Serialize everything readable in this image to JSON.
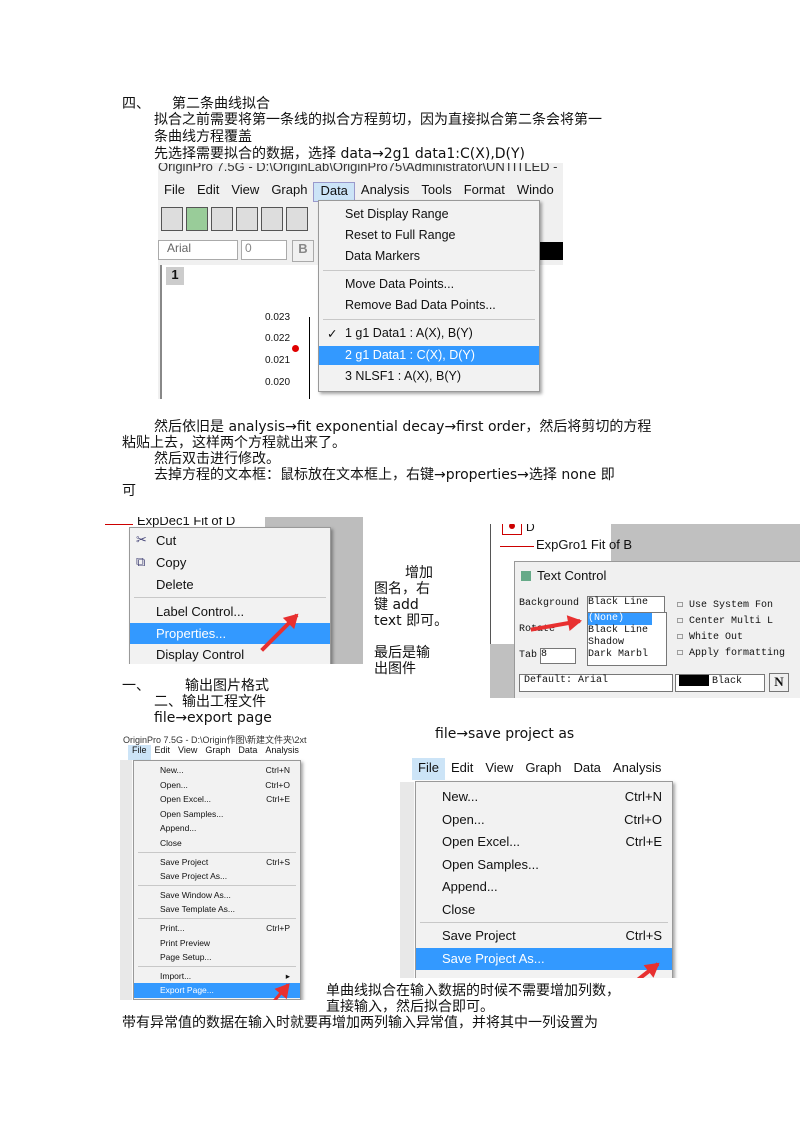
{
  "section4": {
    "num": "四、",
    "title": "第二条曲线拟合",
    "p1a": "拟合之前需要将第一条线的拟合方程剪切，因为直接拟合第二条会将第一",
    "p1b": "条曲线方程覆盖",
    "p2": "先选择需要拟合的数据，选择 data→2g1 data1:C(X),D(Y)"
  },
  "shot1": {
    "title": "OriginPro 7.5G - D:\\OriginLab\\OriginPro75\\Administrator\\UNTITLED -",
    "menus": [
      "File",
      "Edit",
      "View",
      "Graph",
      "Data",
      "Analysis",
      "Tools",
      "Format",
      "Windo"
    ],
    "font": "Arial",
    "size": "0",
    "bold": "B",
    "layer": "1",
    "yticks": [
      "0.023",
      "0.022",
      "0.021",
      "0.020"
    ],
    "data_menu": [
      "Set Display Range",
      "Reset to Full Range",
      "Data Markers",
      "Move Data Points...",
      "Remove Bad Data Points...",
      "1 g1 Data1 : A(X), B(Y)",
      "2 g1 Data1 : C(X), D(Y)",
      "3    NLSF1 : A(X), B(Y)"
    ],
    "point_color": "#e00000",
    "highlight": "#3399ff"
  },
  "para2": {
    "l1": "然后依旧是 analysis→fit exponential decay→first order，然后将剪切的方程",
    "l2": "粘贴上去，这样两个方程就出来了。",
    "l3": "然后双击进行修改。",
    "l4": "去掉方程的文本框：鼠标放在文本框上，右键→properties→选择 none 即",
    "l5": "可"
  },
  "shot2": {
    "legend": "ExpDec1 Fit of D",
    "items": [
      "Cut",
      "Copy",
      "Delete",
      "Label Control...",
      "Properties...",
      "Display Control"
    ]
  },
  "mid": {
    "l1": "增加",
    "l2": "图名，右",
    "l3": "键 add",
    "l4": "text 即可。",
    "l5": "最后是输",
    "l6": "出图件"
  },
  "shot3": {
    "legend1": "D",
    "legend2": "ExpGro1 Fit of B",
    "dialog_title": "Text Control",
    "bg_label": "Background",
    "bg_value": "Black Line",
    "rotate": "Rotate",
    "tab": "Tab",
    "tab_value": "8",
    "options": [
      "(None)",
      "Black Line",
      "Shadow",
      "Dark Marbl"
    ],
    "checks": [
      "Use System Fon",
      "Center Multi L",
      "White Out",
      "Apply formatting"
    ],
    "font": "Default: Arial",
    "color": "Black",
    "n": "N"
  },
  "section": {
    "one_num": "一、",
    "one": "输出图片格式",
    "two": "二、输出工程文件",
    "export": "file→export page",
    "save": "file→save project as"
  },
  "shot4": {
    "title": "OriginPro 7.5G - D:\\Origin作图\\新建文件夹\\2xt",
    "menus": [
      "File",
      "Edit",
      "View",
      "Graph",
      "Data",
      "Analysis"
    ],
    "items": [
      {
        "l": "New...",
        "s": "Ctrl+N"
      },
      {
        "l": "Open...",
        "s": "Ctrl+O"
      },
      {
        "l": "Open Excel...",
        "s": "Ctrl+E"
      },
      {
        "l": "Open Samples...",
        "s": ""
      },
      {
        "l": "Append...",
        "s": ""
      },
      {
        "l": "Close",
        "s": ""
      },
      {
        "l": "Save Project",
        "s": "Ctrl+S"
      },
      {
        "l": "Save Project As...",
        "s": ""
      },
      {
        "l": "Save Window As...",
        "s": ""
      },
      {
        "l": "Save Template As...",
        "s": ""
      },
      {
        "l": "Print...",
        "s": "Ctrl+P"
      },
      {
        "l": "Print Preview",
        "s": ""
      },
      {
        "l": "Page Setup...",
        "s": ""
      },
      {
        "l": "Import...",
        "s": "▸"
      },
      {
        "l": "Export Page...",
        "s": ""
      }
    ]
  },
  "shot5": {
    "menus": [
      "File",
      "Edit",
      "View",
      "Graph",
      "Data",
      "Analysis"
    ],
    "items": [
      {
        "l": "New...",
        "s": "Ctrl+N"
      },
      {
        "l": "Open...",
        "s": "Ctrl+O"
      },
      {
        "l": "Open Excel...",
        "s": "Ctrl+E"
      },
      {
        "l": "Open Samples...",
        "s": ""
      },
      {
        "l": "Append...",
        "s": ""
      },
      {
        "l": "Close",
        "s": ""
      },
      {
        "l": "Save Project",
        "s": "Ctrl+S"
      },
      {
        "l": "Save Project As...",
        "s": ""
      }
    ]
  },
  "para3": {
    "l1": "单曲线拟合在输入数据的时候不需要增加列数，",
    "l2": "直接输入，然后拟合即可。",
    "l3": "带有异常值的数据在输入时就要再增加两列输入异常值，并将其中一列设置为"
  }
}
